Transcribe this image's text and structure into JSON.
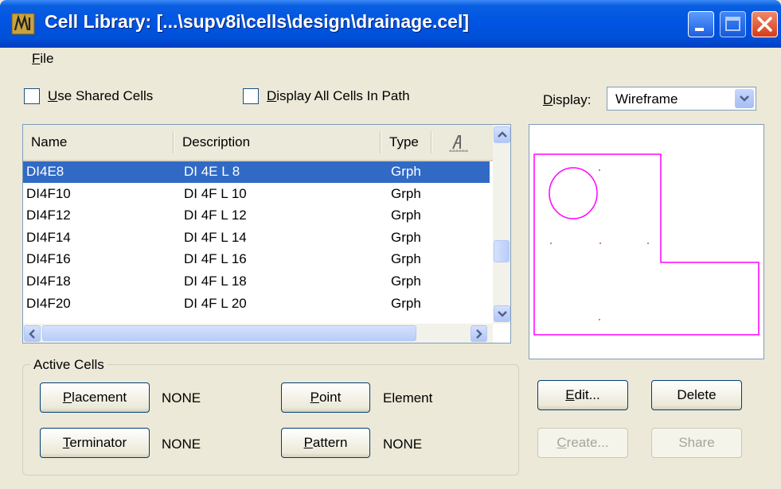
{
  "window": {
    "title": "Cell Library: [...\\supv8i\\cells\\design\\drainage.cel]"
  },
  "menu": {
    "file": "File"
  },
  "options": {
    "use_shared_cells": "Use Shared Cells",
    "display_all_cells": "Display All Cells In Path",
    "display_label": "Display:",
    "display_value": "Wireframe"
  },
  "list": {
    "columns": {
      "name": "Name",
      "description": "Description",
      "type": "Type"
    },
    "rows": [
      {
        "name": "DI4E8",
        "description": "DI 4E L 8",
        "type": "Grph",
        "selected": true
      },
      {
        "name": "DI4F10",
        "description": "DI 4F L 10",
        "type": "Grph"
      },
      {
        "name": "DI4F12",
        "description": "DI 4F L 12",
        "type": "Grph"
      },
      {
        "name": "DI4F14",
        "description": "DI 4F L 14",
        "type": "Grph"
      },
      {
        "name": "DI4F16",
        "description": "DI 4F L 16",
        "type": "Grph"
      },
      {
        "name": "DI4F18",
        "description": "DI 4F L 18",
        "type": "Grph"
      },
      {
        "name": "DI4F20",
        "description": "DI 4F L 20",
        "type": "Grph"
      }
    ]
  },
  "active_cells": {
    "title": "Active Cells",
    "placement_label": "Placement",
    "placement_value": "NONE",
    "terminator_label": "Terminator",
    "terminator_value": "NONE",
    "point_label": "Point",
    "point_value": "Element",
    "pattern_label": "Pattern",
    "pattern_value": "NONE"
  },
  "actions": {
    "edit": "Edit...",
    "delete": "Delete",
    "create": "Create...",
    "share": "Share"
  },
  "colors": {
    "titlebar": "#0054e3",
    "selection": "#316ac5",
    "preview_shape": "#ff00ff",
    "window_bg": "#ece9d8"
  }
}
